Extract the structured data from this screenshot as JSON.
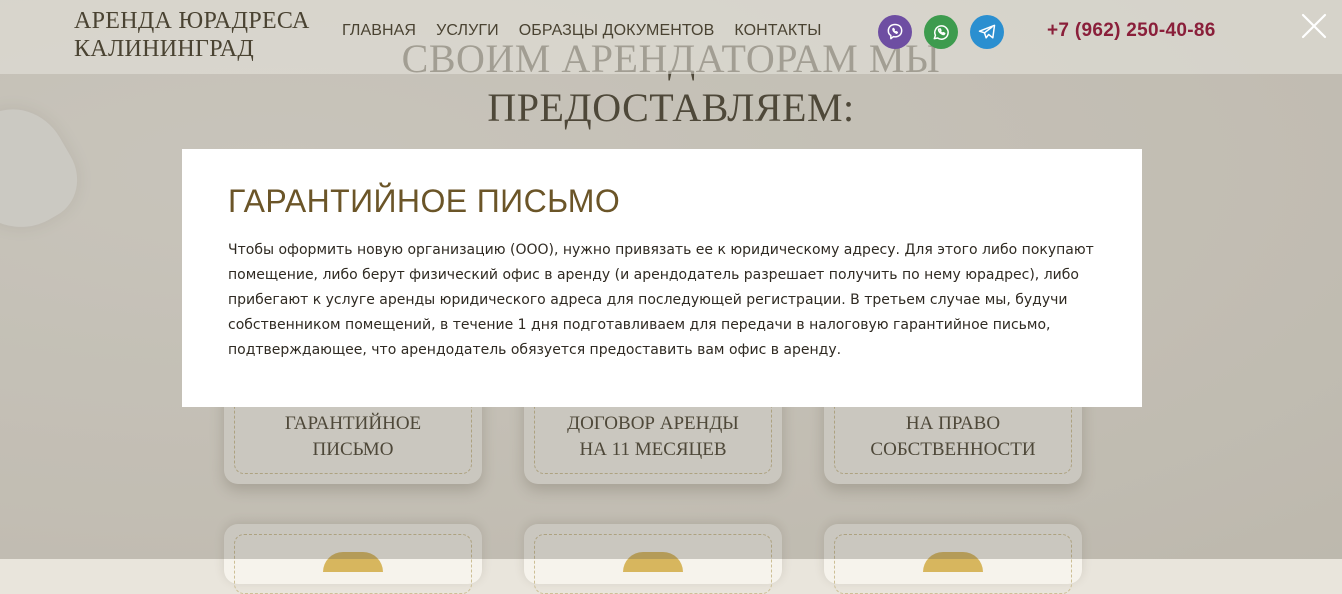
{
  "header": {
    "logo_line1": "АРЕНДА ЮРАДРЕСА",
    "logo_line2": "КАЛИНИНГРАД",
    "nav": [
      {
        "label": "ГЛАВНАЯ"
      },
      {
        "label": "УСЛУГИ"
      },
      {
        "label": "ОБРАЗЦЫ ДОКУМЕНТОВ"
      },
      {
        "label": "КОНТАКТЫ"
      }
    ],
    "socials": [
      {
        "icon": "viber-icon",
        "color": "#6e4ea2"
      },
      {
        "icon": "whatsapp-icon",
        "color": "#3d9b4e"
      },
      {
        "icon": "telegram-icon",
        "color": "#2b8fd0"
      }
    ],
    "phone": "+7 (962) 250-40-86"
  },
  "page": {
    "heading_line1": "СВОИМ АРЕНДАТОРАМ МЫ",
    "heading_line2": "ПРЕДОСТАВЛЯЕМ:",
    "cards": [
      {
        "line1": "ГАРАНТИЙНОЕ",
        "line2": "ПИСЬМО"
      },
      {
        "line1": "ДОГОВОР АРЕНДЫ",
        "line2": "НА 11 МЕСЯЦЕВ"
      },
      {
        "line1": "НА ПРАВО",
        "line2": "СОБСТВЕННОСТИ"
      }
    ]
  },
  "modal": {
    "title": "ГАРАНТИЙНОЕ ПИСЬМО",
    "text": "Чтобы оформить новую организацию (ООО), нужно привязать ее к юридическому адресу. Для этого либо покупают помещение, либо берут физический офис в аренду (и арендодатель разрешает получить по нему юрадрес), либо прибегают к услуге аренды юридического адреса для последующей регистрации. В третьем случае мы, будучи собственником помещений, в течение 1 дня подготавливаем для передачи в налоговую гарантийное письмо, подтверждающее, что арендодатель обязуется предоставить вам офис в аренду.",
    "close_icon": "close-icon"
  },
  "colors": {
    "accent_brown": "#6b5528",
    "phone_red": "#8a1f3a",
    "overlay": "rgba(90,85,75,0.28)"
  }
}
